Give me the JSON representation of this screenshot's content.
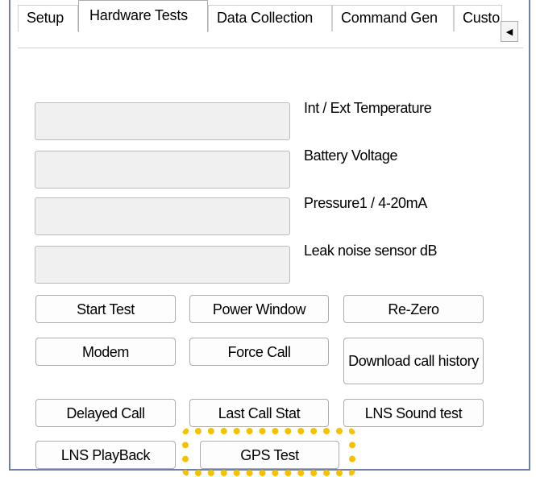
{
  "tabs": [
    {
      "label": "Setup",
      "active": false
    },
    {
      "label": "Hardware Tests",
      "active": true
    },
    {
      "label": "Data Collection",
      "active": false
    },
    {
      "label": "Command Gen",
      "active": false
    },
    {
      "label": "Custo",
      "active": false
    }
  ],
  "tab_scroll_icon": "arrow-left-icon",
  "readouts": [
    {
      "label": "Int / Ext Temperature",
      "value": ""
    },
    {
      "label": "Battery Voltage",
      "value": ""
    },
    {
      "label": "Pressure1 / 4-20mA",
      "value": ""
    },
    {
      "label": "Leak noise sensor dB",
      "value": ""
    }
  ],
  "buttons": {
    "start_test": "Start Test",
    "power_window": "Power Window",
    "re_zero": "Re-Zero",
    "modem": "Modem",
    "force_call": "Force Call",
    "download_call_history": "Download call history",
    "delayed_call": "Delayed Call",
    "last_call_stat": "Last Call Stat",
    "lns_sound_test": "LNS Sound test",
    "lns_playback": "LNS PlayBack",
    "gps_test": "GPS Test"
  },
  "colors": {
    "highlight": "#f5c200",
    "frame_border": "#6f7fa8",
    "readout_fill": "#f0f0f0"
  }
}
